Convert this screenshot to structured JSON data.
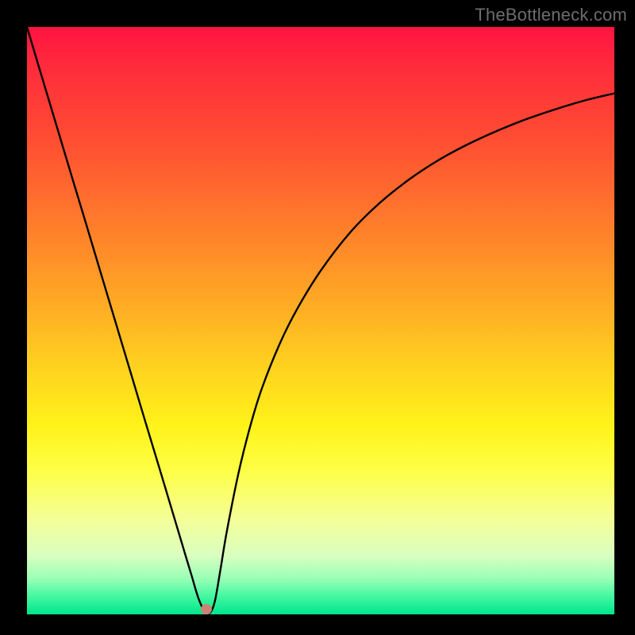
{
  "watermark": "TheBottleneck.com",
  "chart_data": {
    "type": "line",
    "title": "",
    "xlabel": "",
    "ylabel": "",
    "xlim": [
      0,
      100
    ],
    "ylim": [
      0,
      100
    ],
    "grid": false,
    "series": [
      {
        "name": "curve",
        "x": [
          0,
          2,
          5,
          8,
          10,
          12,
          15,
          18,
          20,
          22,
          25,
          27,
          28,
          29,
          29.8,
          30.5,
          31.2,
          32,
          33,
          34,
          36,
          38,
          40,
          43,
          46,
          50,
          55,
          60,
          65,
          70,
          75,
          80,
          85,
          90,
          95,
          100
        ],
        "values": [
          100,
          93.3,
          83.3,
          73.3,
          66.7,
          60,
          50,
          40,
          33.3,
          26.7,
          16.7,
          10,
          6.7,
          3.3,
          1.3,
          0.5,
          0.3,
          2.3,
          8,
          14,
          24,
          32,
          38.5,
          46,
          52,
          58.5,
          65,
          70,
          74,
          77.3,
          80,
          82.3,
          84.3,
          86,
          87.5,
          88.7
        ]
      }
    ],
    "minimum_marker": {
      "x": 30.5,
      "y": 0.5
    },
    "background_gradient": {
      "orientation": "vertical",
      "stops": [
        {
          "pos": 0.0,
          "color": "#ff1341"
        },
        {
          "pos": 0.5,
          "color": "#ffd21f"
        },
        {
          "pos": 0.85,
          "color": "#f4ff99"
        },
        {
          "pos": 1.0,
          "color": "#00e58b"
        }
      ]
    }
  }
}
